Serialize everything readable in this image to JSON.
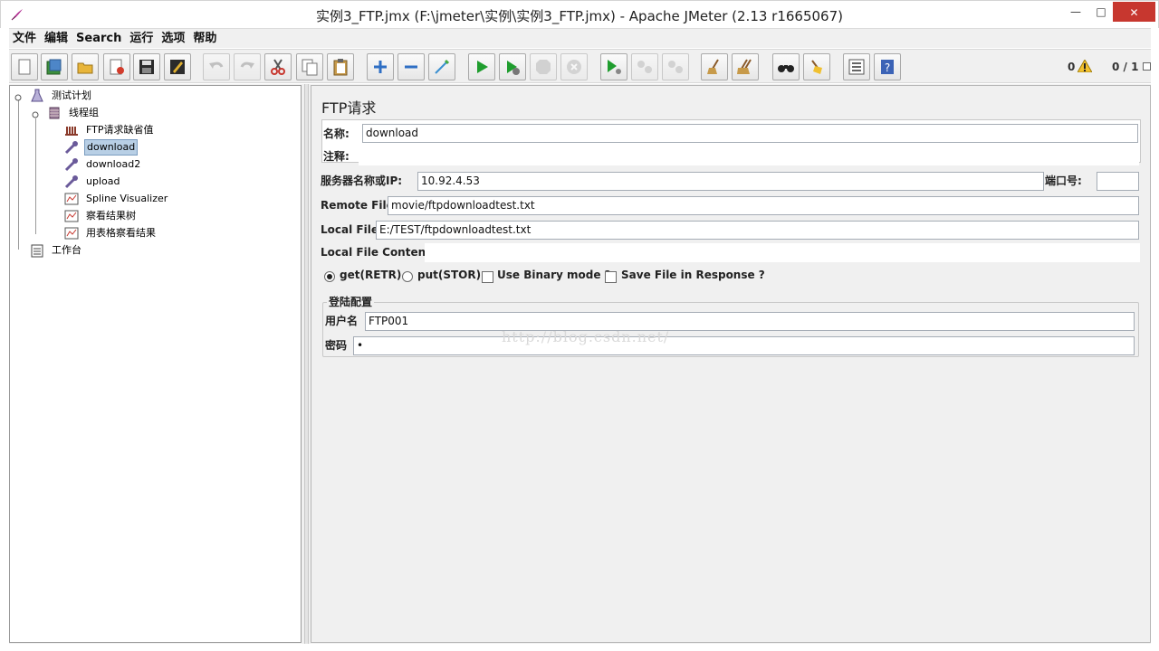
{
  "window": {
    "title": "实例3_FTP.jmx (F:\\jmeter\\实例\\实例3_FTP.jmx) - Apache JMeter (2.13 r1665067)",
    "minimize_glyph": "—",
    "maximize_glyph": "□",
    "close_glyph": "✕"
  },
  "menu": [
    "文件",
    "编辑",
    "Search",
    "运行",
    "选项",
    "帮助"
  ],
  "toolbar": {
    "buttons": [
      "new",
      "templates",
      "open",
      "close",
      "save",
      "save-as-image",
      "undo",
      "redo",
      "cut",
      "copy",
      "paste",
      "expand",
      "collapse",
      "toggle",
      "start",
      "start-no-pause",
      "stop",
      "shutdown",
      "remote-start-all",
      "remote-stop-all",
      "remote-shutdown-all",
      "clear",
      "clear-all",
      "search",
      "reset-search",
      "function-helper",
      "help"
    ],
    "error_count": "0",
    "thread_count": "0 / 1"
  },
  "tree": {
    "items": [
      {
        "label": "测试计划",
        "icon": "test-plan-icon"
      },
      {
        "label": "线程组",
        "icon": "thread-group-icon"
      },
      {
        "label": "FTP请求缺省值",
        "icon": "config-element-icon"
      },
      {
        "label": "download",
        "icon": "sampler-icon"
      },
      {
        "label": "download2",
        "icon": "sampler-icon"
      },
      {
        "label": "upload",
        "icon": "sampler-icon"
      },
      {
        "label": "Spline Visualizer",
        "icon": "listener-icon"
      },
      {
        "label": "察看结果树",
        "icon": "listener-icon"
      },
      {
        "label": "用表格察看结果",
        "icon": "listener-icon"
      },
      {
        "label": "工作台",
        "icon": "workbench-icon"
      }
    ],
    "selected": "download"
  },
  "form": {
    "title": "FTP请求",
    "name_label": "名称:",
    "name_value": "download",
    "comments_label": "注释:",
    "comments_value": "",
    "server_label": "服务器名称或IP:",
    "server_value": "10.92.4.53",
    "port_label": "端口号:",
    "port_value": "",
    "remote_file_label": "Remote File:",
    "remote_file_value": "movie/ftpdownloadtest.txt",
    "local_file_label": "Local File:",
    "local_file_value": "E:/TEST/ftpdownloadtest.txt",
    "local_contents_label": "Local File Contents:",
    "local_contents_value": "",
    "options": {
      "get_label": "get(RETR)",
      "get_checked": true,
      "put_label": "put(STOR)",
      "put_checked": false,
      "binary_label": "Use Binary mode ?",
      "binary_checked": false,
      "save_label": "Save File in Response ?",
      "save_checked": false
    },
    "login": {
      "group_title": "登陆配置",
      "username_label": "用户名",
      "username_value": "FTP001",
      "password_label": "密码",
      "password_value": "•"
    }
  },
  "watermark": "http://blog.csdn.net/",
  "colors": {
    "window_bg": "#f0f0f0",
    "close_button": "#c7372f",
    "selection": "#b8cfe5",
    "start_green": "#1f9d2e",
    "help_blue": "#3b63b6"
  }
}
